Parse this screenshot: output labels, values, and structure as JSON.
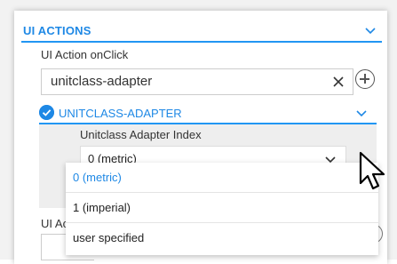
{
  "section": {
    "title": "UI ACTIONS",
    "onclick_label": "UI Action onClick",
    "onclick_value": "unitclass-adapter"
  },
  "adapter": {
    "title": "UNITCLASS-ADAPTER",
    "index_label": "Unitclass Adapter Index",
    "selected_value": "0 (metric)",
    "options": [
      {
        "label": "0 (metric)",
        "selected": true
      },
      {
        "label": "1 (imperial)",
        "selected": false
      },
      {
        "label": "user specified",
        "selected": false
      }
    ]
  },
  "next_field": {
    "label_partial": "UI Ac"
  },
  "colors": {
    "accent": "#1e88e5",
    "selected_option": "#1e88e5",
    "text": "#333333"
  },
  "icons": [
    "chevron-down-icon",
    "clear-icon",
    "add-circle-icon",
    "check-circle-icon",
    "mouse-pointer-icon"
  ]
}
